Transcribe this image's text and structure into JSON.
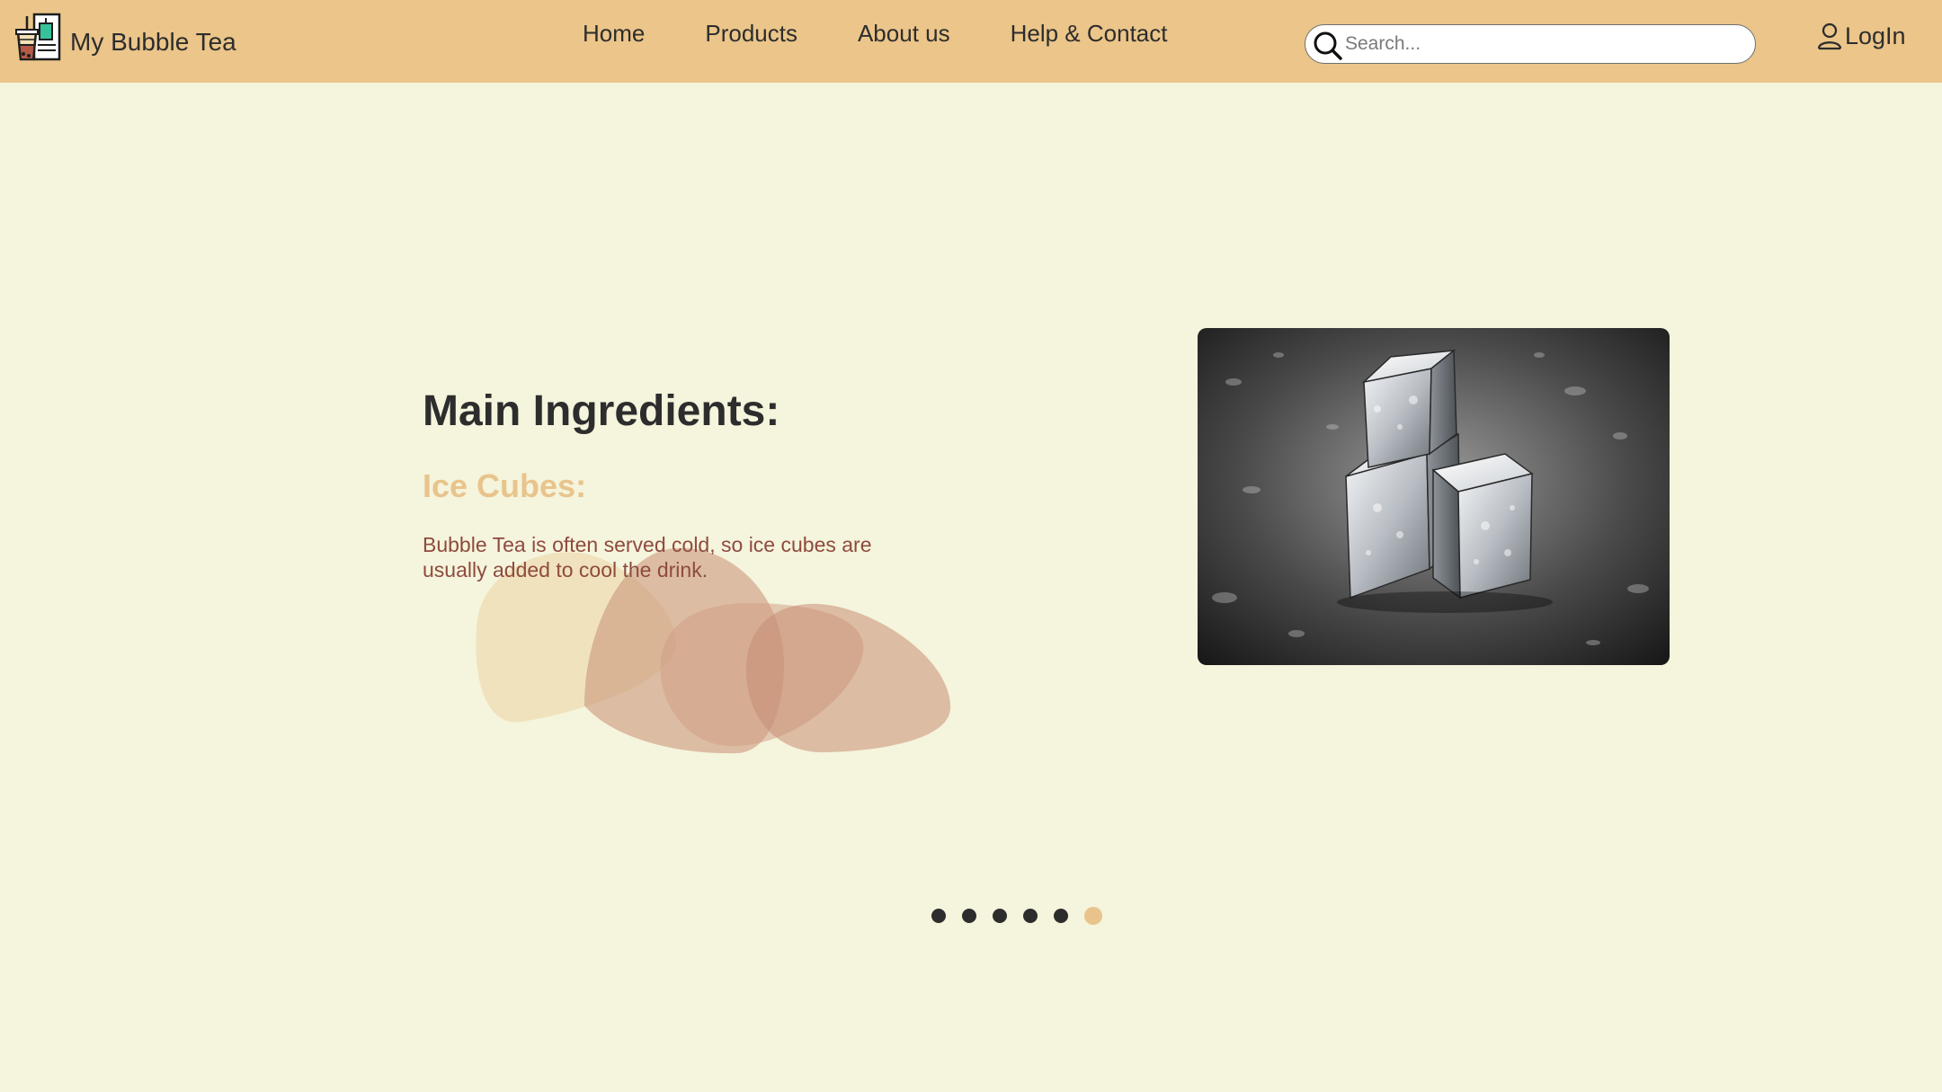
{
  "brand": {
    "name": "My Bubble Tea",
    "logo_icon": "bubble-tea-shop-icon"
  },
  "nav": {
    "items": [
      {
        "label": "Home"
      },
      {
        "label": "Products"
      },
      {
        "label": "About us"
      },
      {
        "label": "Help & Contact"
      }
    ]
  },
  "search": {
    "placeholder": "Search...",
    "value": "",
    "icon": "search-icon"
  },
  "login": {
    "label": "LogIn",
    "icon": "user-icon"
  },
  "slide": {
    "title": "Main Ingredients:",
    "subtitle": "Ice Cubes:",
    "text": "Bubble Tea is often served cold, so ice cubes are usually added to cool the drink.",
    "image_alt": "ice-cubes-photo"
  },
  "carousel": {
    "slide_count": 6,
    "active_index": 5
  },
  "colors": {
    "header_bg": "#ebc589",
    "page_bg": "#f5f4dc",
    "accent": "#e8c48c",
    "text_dark": "#2d2d2d",
    "text_body": "#8e4b3f"
  }
}
